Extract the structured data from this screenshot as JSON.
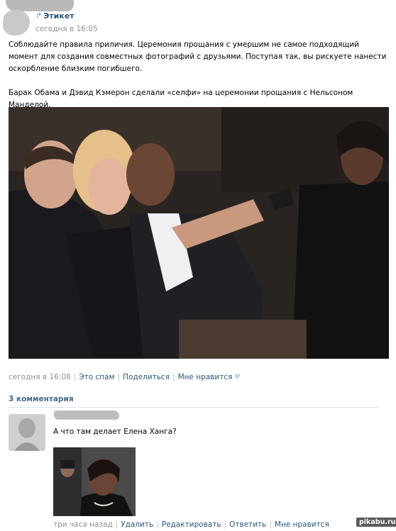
{
  "post": {
    "author": "Этикет",
    "repost_icon": "repost-arrow-icon",
    "time": "сегодня в 16:05",
    "text_1": "Соблюдайте правила приличия. Церемония прощания с умершим не самое подходящий момент для создания совместных фотографий с друзьями. Поступая так, вы рискуете нанести оскорбление близким погибшего.",
    "text_2": "Барак Обама и Дэвид Кэмерон сделали «селфи» на церемонии прощания с Нельсоном Манделой.",
    "meta": {
      "time": "сегодня в 16:08",
      "spam": "Это спам",
      "share": "Поделиться",
      "like": "Мне нравится",
      "like_icon": "heart-icon"
    }
  },
  "comments": {
    "title": "3 комментария",
    "items": [
      {
        "text": "А что там делает Елена Ханга?",
        "meta": {
          "time": "три часа назад",
          "delete": "Удалить",
          "edit": "Редактировать",
          "reply": "Ответить",
          "like": "Мне нравится"
        }
      }
    ]
  },
  "watermark": "pikabu.ru",
  "colors": {
    "link": "#2b587a",
    "muted": "#909090",
    "comments_header": "#45688e"
  }
}
